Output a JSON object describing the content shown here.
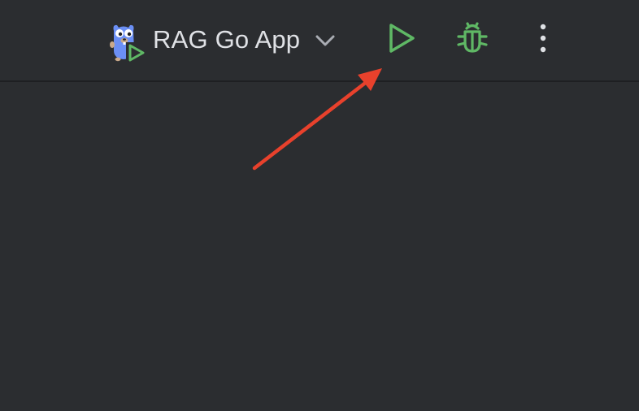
{
  "toolbar": {
    "run_configuration": {
      "label": "RAG Go App",
      "icon": "go-gopher-run-icon",
      "dropdown_icon": "chevron-down-icon"
    },
    "run_button": {
      "icon": "run-icon"
    },
    "debug_button": {
      "icon": "bug-icon"
    },
    "more_button": {
      "icon": "more-vertical-icon"
    }
  },
  "annotation": {
    "type": "arrow",
    "target": "run_button",
    "color": "#e8412c"
  },
  "colors": {
    "background": "#2b2d30",
    "divider": "#1e1f22",
    "text": "#dfe1e5",
    "run_green": "#5fb865",
    "gopher_blue": "#6b8ff5",
    "annotation_red": "#e8412c"
  }
}
